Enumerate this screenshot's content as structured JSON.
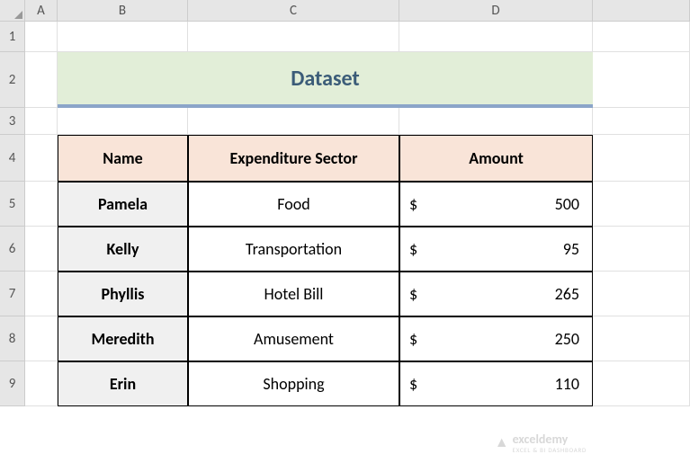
{
  "columns": [
    "A",
    "B",
    "C",
    "D"
  ],
  "rows": [
    "1",
    "2",
    "3",
    "4",
    "5",
    "6",
    "7",
    "8",
    "9"
  ],
  "title": "Dataset",
  "headers": {
    "name": "Name",
    "sector": "Expenditure Sector",
    "amount": "Amount"
  },
  "data": [
    {
      "name": "Pamela",
      "sector": "Food",
      "amount": "500"
    },
    {
      "name": "Kelly",
      "sector": "Transportation",
      "amount": "95"
    },
    {
      "name": "Phyllis",
      "sector": "Hotel Bill",
      "amount": "265"
    },
    {
      "name": "Meredith",
      "sector": "Amusement",
      "amount": "250"
    },
    {
      "name": "Erin",
      "sector": "Shopping",
      "amount": "110"
    }
  ],
  "currency_symbol": "$",
  "watermark": {
    "brand": "exceldemy",
    "sub": "EXCEL & BI DASHBOARD"
  }
}
